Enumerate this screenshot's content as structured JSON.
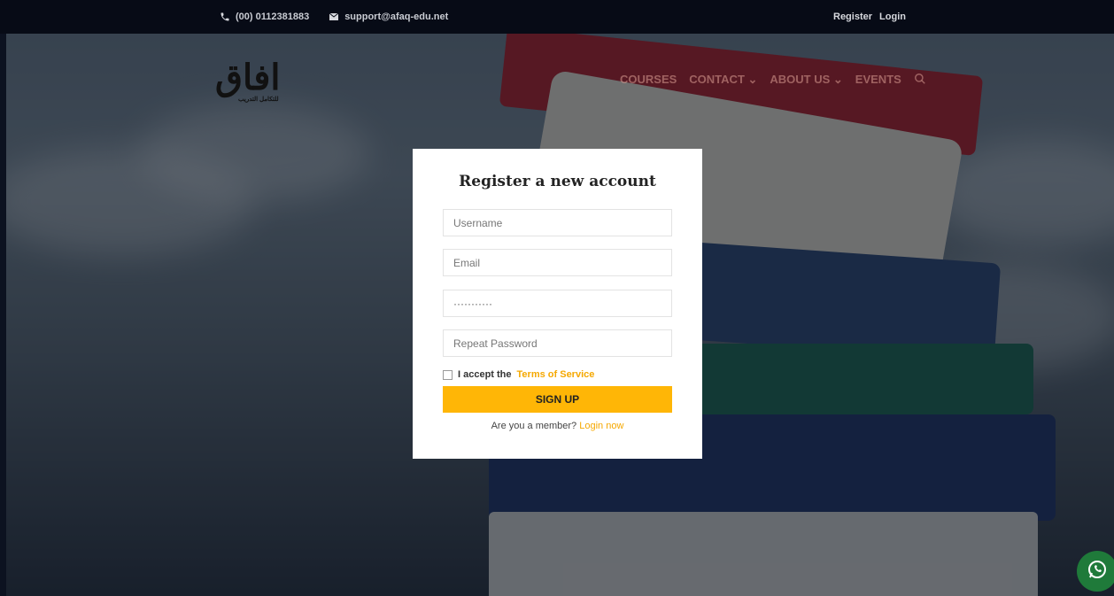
{
  "topbar": {
    "phone": "(00) 0112381883",
    "email": "support@afaq-edu.net",
    "register": "Register",
    "login": "Login"
  },
  "logo": {
    "mark": "افاق",
    "tagline": "للتكامل التدريب"
  },
  "nav": {
    "items": [
      "COURSES",
      "CONTACT ⌄",
      "ABOUT US ⌄",
      "EVENTS"
    ]
  },
  "form": {
    "title": "Register a new account",
    "username_placeholder": "Username",
    "email_placeholder": "Email",
    "password_value": "···········",
    "repeat_placeholder": "Repeat Password",
    "accept_text": "I accept the",
    "terms_link": "Terms of Service",
    "submit": "SIGN UP",
    "member_text": "Are you a member?",
    "login_link": "Login now"
  },
  "colors": {
    "accent": "#ffb606",
    "topbar": "#070b16"
  }
}
